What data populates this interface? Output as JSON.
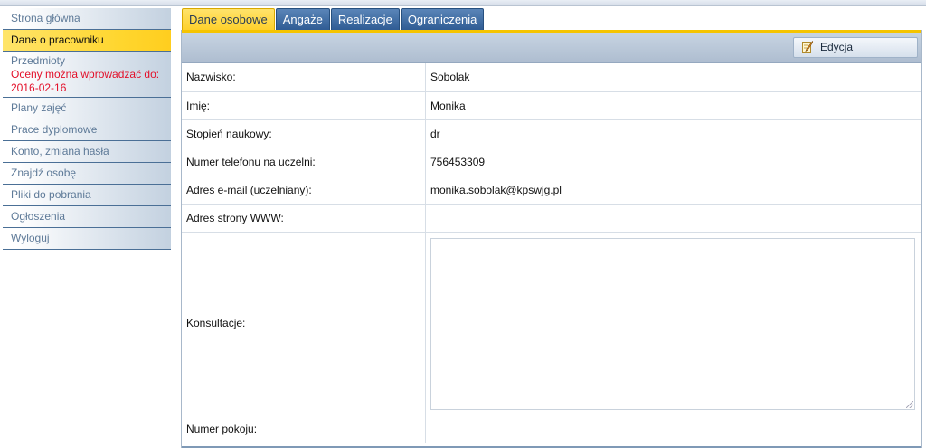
{
  "sidebar": {
    "items": [
      {
        "label": "Strona główna"
      },
      {
        "label": "Dane o pracowniku"
      },
      {
        "label": "Przedmioty",
        "note": "Oceny można wprowadzać do: 2016-02-16"
      },
      {
        "label": "Plany zajęć"
      },
      {
        "label": "Prace dyplomowe"
      },
      {
        "label": "Konto, zmiana hasła"
      },
      {
        "label": "Znajdź osobę"
      },
      {
        "label": "Pliki do pobrania"
      },
      {
        "label": "Ogłoszenia"
      },
      {
        "label": "Wyloguj"
      }
    ]
  },
  "tabs": [
    {
      "label": "Dane osobowe"
    },
    {
      "label": "Angaże"
    },
    {
      "label": "Realizacje"
    },
    {
      "label": "Ograniczenia"
    }
  ],
  "toolbar": {
    "edit_label": "Edycja",
    "edit_icon": "pencil-note-icon"
  },
  "form": {
    "rows": [
      {
        "label": "Nazwisko:",
        "value": "Sobolak"
      },
      {
        "label": "Imię:",
        "value": "Monika"
      },
      {
        "label": "Stopień naukowy:",
        "value": "dr"
      },
      {
        "label": "Numer telefonu na uczelni:",
        "value": "756453309"
      },
      {
        "label": "Adres e-mail (uczelniany):",
        "value": "monika.sobolak@kpswjg.pl"
      },
      {
        "label": "Adres strony WWW:",
        "value": ""
      },
      {
        "label": "Konsultacje:",
        "value": ""
      },
      {
        "label": "Numer pokoju:",
        "value": ""
      }
    ]
  },
  "colors": {
    "accent": "#ffd62e",
    "tab_blue": "#2f5c94",
    "note_red": "#e3102a"
  }
}
